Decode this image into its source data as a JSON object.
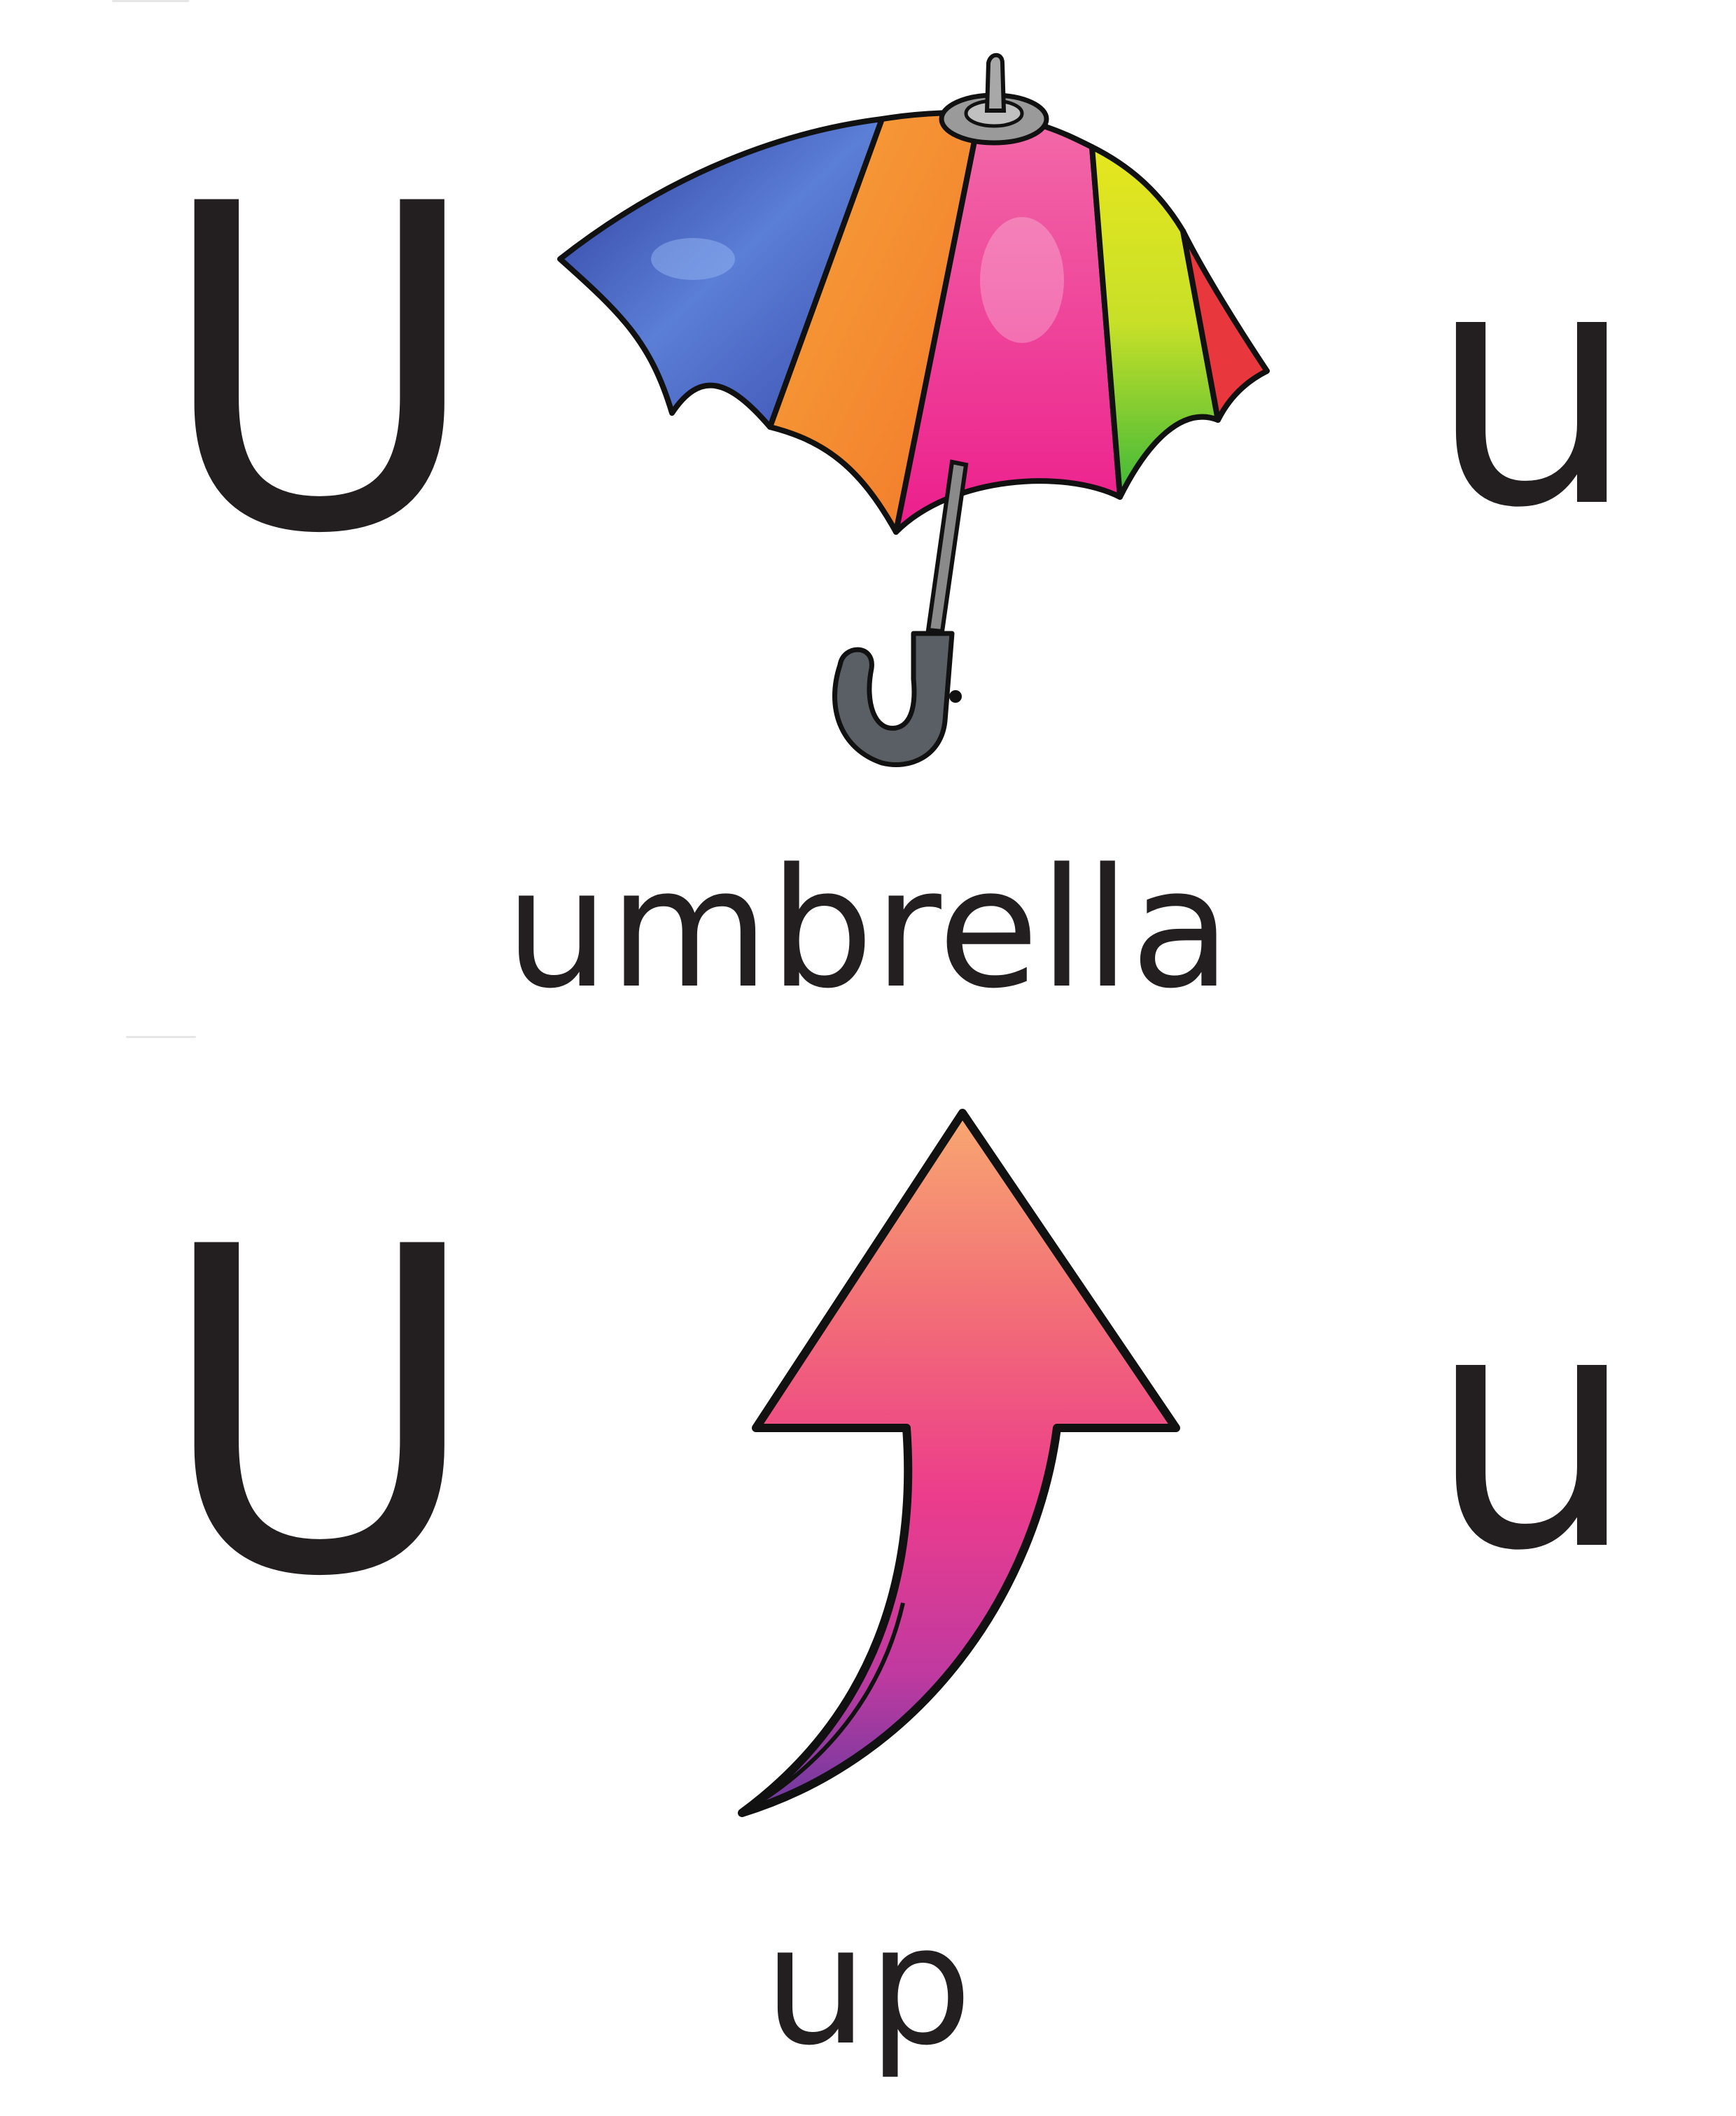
{
  "cards": [
    {
      "uppercase": "U",
      "lowercase": "u",
      "word": "umbrella",
      "picture": "umbrella-icon"
    },
    {
      "uppercase": "U",
      "lowercase": "u",
      "word": "up",
      "picture": "up-arrow-icon"
    }
  ],
  "colors": {
    "text": "#231f20",
    "umbrella_blue": "#3b4fb0",
    "umbrella_orange": "#f7941d",
    "umbrella_pink": "#ec1e8c",
    "umbrella_yellow": "#e6e61e",
    "umbrella_green": "#3db83a",
    "umbrella_red": "#e8383d",
    "arrow_top": "#f59a6a",
    "arrow_mid": "#ec3c8c",
    "arrow_bottom": "#7a3a9a"
  }
}
